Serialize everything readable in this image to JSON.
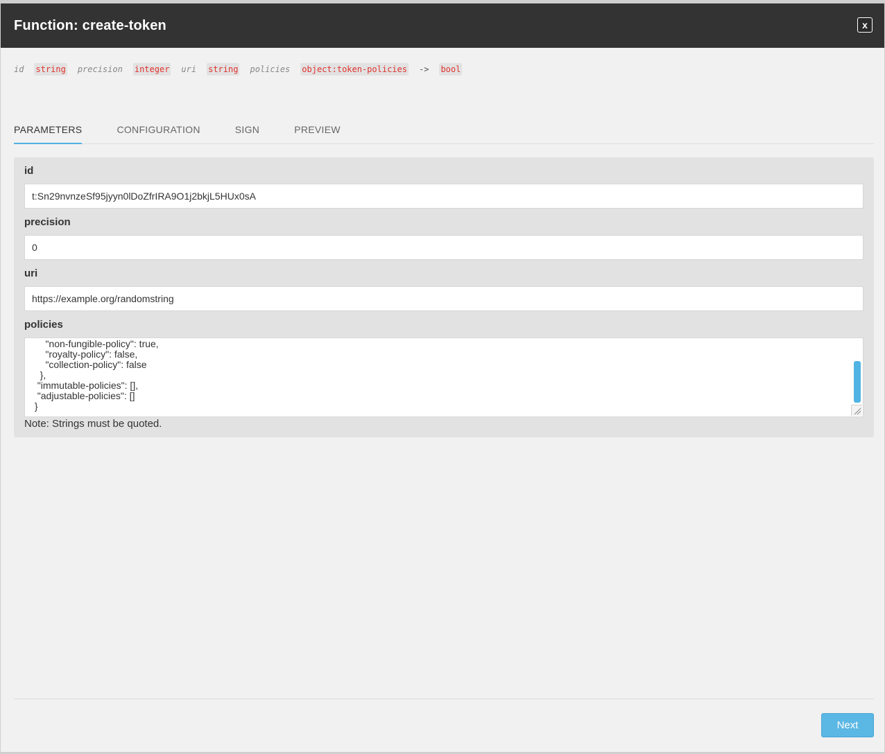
{
  "dialog": {
    "title": "Function: create-token",
    "close_label": "x"
  },
  "signature": {
    "params": [
      {
        "name": "id",
        "type": "string"
      },
      {
        "name": "precision",
        "type": "integer"
      },
      {
        "name": "uri",
        "type": "string"
      },
      {
        "name": "policies",
        "type": "object:token-policies"
      }
    ],
    "arrow": "->",
    "return_type": "bool"
  },
  "tabs": [
    {
      "label": "PARAMETERS",
      "active": true
    },
    {
      "label": "CONFIGURATION",
      "active": false
    },
    {
      "label": "SIGN",
      "active": false
    },
    {
      "label": "PREVIEW",
      "active": false
    }
  ],
  "fields": {
    "id": {
      "label": "id",
      "value": "t:Sn29nvnzeSf95jyyn0lDoZfrIRA9O1j2bkjL5HUx0sA"
    },
    "precision": {
      "label": "precision",
      "value": "0"
    },
    "uri": {
      "label": "uri",
      "value": "https://example.org/randomstring"
    },
    "policies": {
      "label": "policies",
      "lines": [
        "     \"non-fungible-policy\": true,",
        "     \"royalty-policy\": false,",
        "     \"collection-policy\": false",
        "   },",
        "  \"immutable-policies\": [],",
        "  \"adjustable-policies\": []",
        " }"
      ]
    }
  },
  "note": "Note: Strings must be quoted.",
  "footer": {
    "next_label": "Next"
  },
  "colors": {
    "accent": "#4fb3e3",
    "type_text": "#e0322d",
    "header_bg": "#333333"
  }
}
